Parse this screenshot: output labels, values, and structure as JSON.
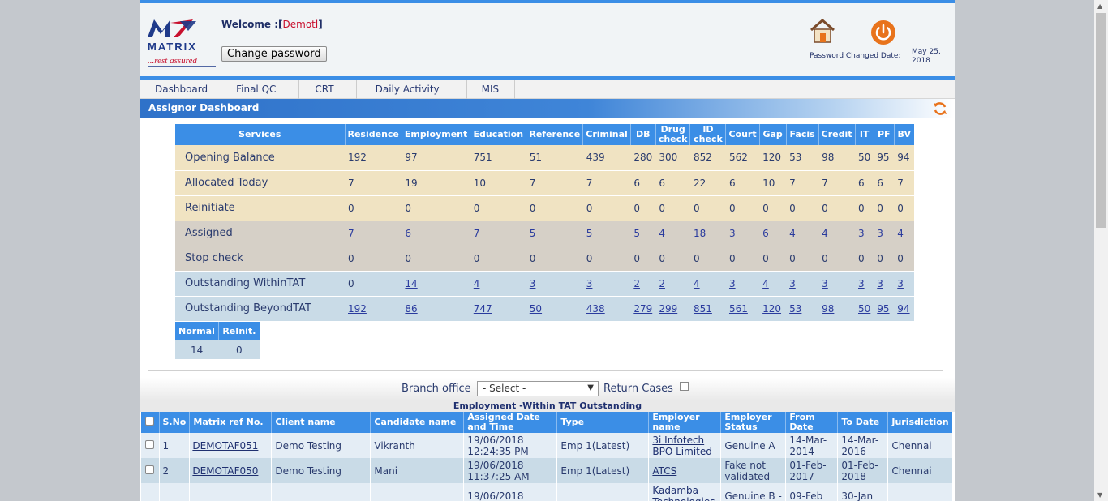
{
  "header": {
    "logo": {
      "brand": "MATRIX",
      "tagline": "...rest assured"
    },
    "welcome_prefix": "Welcome :[",
    "welcome_user": "Demotl",
    "welcome_suffix": "]",
    "change_password": "Change password",
    "password_changed_label": "Password Changed Date:",
    "password_changed_date": "May 25, 2018"
  },
  "nav": {
    "items": [
      {
        "label": "Dashboard"
      },
      {
        "label": "Final QC"
      },
      {
        "label": "CRT"
      },
      {
        "label": "Daily Activity"
      },
      {
        "label": "MIS"
      }
    ]
  },
  "dashboard": {
    "title": "Assignor Dashboard",
    "services_header": [
      "Services",
      "Residence",
      "Employment",
      "Education",
      "Reference",
      "Criminal",
      "DB",
      "Drug check",
      "ID check",
      "Court",
      "Gap",
      "Facis",
      "Credit",
      "IT",
      "PF",
      "BV"
    ],
    "rows": [
      {
        "label": "Opening Balance",
        "values": [
          "192",
          "97",
          "751",
          "51",
          "439",
          "280",
          "300",
          "852",
          "562",
          "120",
          "53",
          "98",
          "50",
          "95",
          "94"
        ]
      },
      {
        "label": "Allocated Today",
        "values": [
          "7",
          "19",
          "10",
          "7",
          "7",
          "6",
          "6",
          "22",
          "6",
          "10",
          "7",
          "7",
          "6",
          "6",
          "7"
        ]
      },
      {
        "label": "Reinitiate",
        "values": [
          "0",
          "0",
          "0",
          "0",
          "0",
          "0",
          "0",
          "0",
          "0",
          "0",
          "0",
          "0",
          "0",
          "0",
          "0"
        ]
      },
      {
        "label": "Assigned",
        "values": [
          "7",
          "6",
          "7",
          "5",
          "5",
          "5",
          "4",
          "18",
          "3",
          "6",
          "4",
          "4",
          "3",
          "3",
          "4"
        ]
      },
      {
        "label": "Stop check",
        "values": [
          "0",
          "0",
          "0",
          "0",
          "0",
          "0",
          "0",
          "0",
          "0",
          "0",
          "0",
          "0",
          "0",
          "0",
          "0"
        ]
      },
      {
        "label": "Outstanding WithinTAT",
        "values": [
          "0",
          "14",
          "4",
          "3",
          "3",
          "2",
          "2",
          "4",
          "3",
          "4",
          "3",
          "3",
          "3",
          "3",
          "3"
        ]
      },
      {
        "label": "Outstanding BeyondTAT",
        "values": [
          "192",
          "86",
          "747",
          "50",
          "438",
          "279",
          "299",
          "851",
          "561",
          "120",
          "53",
          "98",
          "50",
          "95",
          "94"
        ]
      }
    ],
    "summary": {
      "headers": [
        "Normal",
        "ReInit."
      ],
      "values": [
        "14",
        "0"
      ]
    }
  },
  "filters": {
    "branch_label": "Branch office",
    "branch_selected": "- Select -",
    "return_label": "Return Cases"
  },
  "employment": {
    "caption": "Employment -Within TAT Outstanding",
    "headers": [
      "S.No",
      "Matrix ref No.",
      "Client name",
      "Candidate name",
      "Assigned Date and Time",
      "Type",
      "Employer name",
      "Employer Status",
      "From Date",
      "To Date",
      "Jurisdiction"
    ],
    "rows": [
      {
        "sno": "1",
        "ref": "DEMOTAF051",
        "client": "Demo Testing",
        "candidate": "Vikranth",
        "assigned": "19/06/2018 12:24:35 PM",
        "type": "Emp 1(Latest)",
        "employer": "3i Infotech BPO Limited",
        "status": "Genuine A",
        "from": "14-Mar-2014",
        "to": "14-Mar-2016",
        "jurisdiction": "Chennai"
      },
      {
        "sno": "2",
        "ref": "DEMOTAF050",
        "client": "Demo Testing",
        "candidate": "Mani",
        "assigned": "19/06/2018 11:37:25 AM",
        "type": "Emp 1(Latest)",
        "employer": "ATCS",
        "status": "Fake not validated",
        "from": "01-Feb-2017",
        "to": "01-Feb-2018",
        "jurisdiction": "Chennai"
      },
      {
        "sno": "",
        "ref": "",
        "client": "",
        "candidate": "",
        "assigned": "19/06/2018",
        "type": "",
        "employer": "Kadamba Technologies",
        "status": "Genuine B -",
        "from": "09-Feb",
        "to": "30-Jan",
        "jurisdiction": ""
      }
    ]
  },
  "colors": {
    "accent": "#3b8ee6",
    "row_tan": "#f0e3c2",
    "row_gray": "#d6d0c7",
    "row_blue": "#c9dbe7",
    "power": "#e8731c"
  }
}
